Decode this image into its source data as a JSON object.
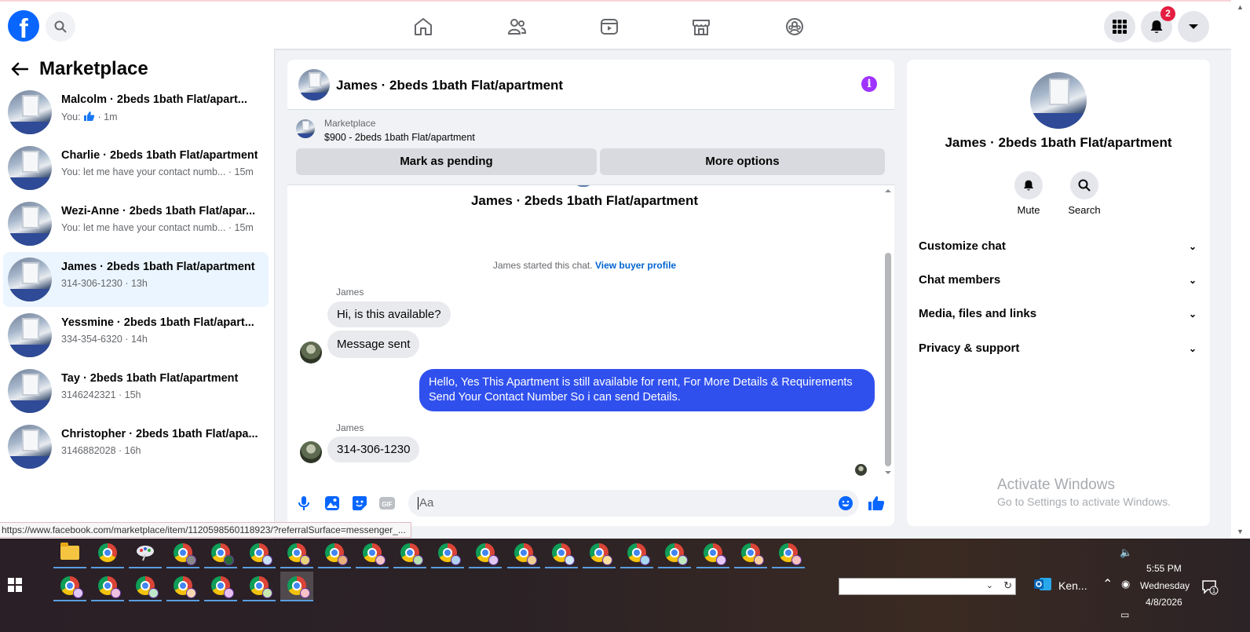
{
  "nav": {
    "logo": "f",
    "notification_count": "2"
  },
  "sidebar": {
    "title": "Marketplace",
    "conversations": [
      {
        "name": "Malcolm · 2beds 1bath Flat/apart...",
        "sub_prefix": "You:",
        "sub": "· 1m",
        "has_like": true,
        "active": false
      },
      {
        "name": "Charlie · 2beds 1bath Flat/apartment",
        "sub_prefix": "",
        "sub": "You: let me have your contact numb... · 15m",
        "has_like": false,
        "active": false
      },
      {
        "name": "Wezi-Anne · 2beds 1bath Flat/apar...",
        "sub_prefix": "",
        "sub": "You: let me have your contact numb... · 15m",
        "has_like": false,
        "active": false
      },
      {
        "name": "James · 2beds 1bath Flat/apartment",
        "sub_prefix": "",
        "sub": "314-306-1230 · 13h",
        "has_like": false,
        "active": true
      },
      {
        "name": "Yessmine · 2beds 1bath Flat/apart...",
        "sub_prefix": "",
        "sub": "334-354-6320 · 14h",
        "has_like": false,
        "active": false
      },
      {
        "name": "Tay · 2beds 1bath Flat/apartment",
        "sub_prefix": "",
        "sub": "3146242321 · 15h",
        "has_like": false,
        "active": false
      },
      {
        "name": "Christopher · 2beds 1bath Flat/apa...",
        "sub_prefix": "",
        "sub": "3146882028 · 16h",
        "has_like": false,
        "active": false
      }
    ]
  },
  "chat": {
    "title": "James · 2beds 1bath Flat/apartment",
    "marketplace_label": "Marketplace",
    "listing": "$900 - 2beds 1bath Flat/apartment",
    "mark_pending": "Mark as pending",
    "more_options": "More options",
    "thread_title": "James · 2beds 1bath Flat/apartment",
    "system_text": "James started this chat.",
    "buyer_profile_link": "View buyer profile",
    "sender1": "James",
    "msg1": "Hi, is this available?",
    "msg2": "Message sent",
    "msg_out": "Hello, Yes This Apartment is still available for rent, For More Details & Requirements Send Your Contact Number So i can send Details.",
    "sender2": "James",
    "msg3": "314-306-1230",
    "composer_placeholder": "Aa"
  },
  "info": {
    "name": "James · 2beds 1bath Flat/apartment",
    "mute": "Mute",
    "search": "Search",
    "sections": [
      "Customize chat",
      "Chat members",
      "Media, files and links",
      "Privacy & support"
    ]
  },
  "watermark": {
    "line1": "Activate Windows",
    "line2": "Go to Settings to activate Windows."
  },
  "status_url": "https://www.facebook.com/marketplace/item/1120598560118923/?referralSurface=messenger_...",
  "taskbar": {
    "app_label": "Ken...",
    "time": "5:55 PM",
    "day": "Wednesday",
    "date": "4/8/2026",
    "notif_count": "1"
  }
}
